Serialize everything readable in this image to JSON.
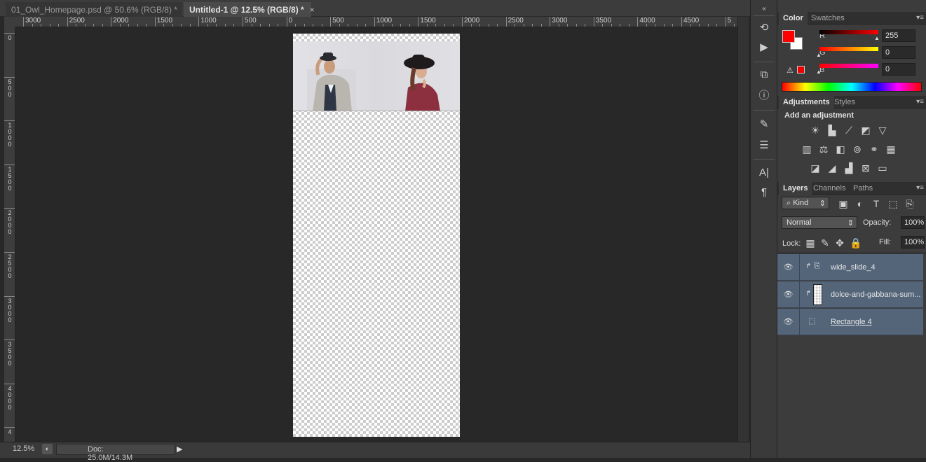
{
  "tabs": [
    {
      "label": "01_Owl_Homepage.psd @ 50.6% (RGB/8) *",
      "close": "×"
    },
    {
      "label": "Untitled-1 @ 12.5% (RGB/8) *",
      "close": "×"
    }
  ],
  "ruler": {
    "h_labels": [
      "3000",
      "2500",
      "2000",
      "1500",
      "1000",
      "500",
      "0",
      "500",
      "1000",
      "1500",
      "2000",
      "2500",
      "3000",
      "3500",
      "4000",
      "4500",
      "5"
    ],
    "v_labels": [
      "0",
      "5 0 0",
      "1 0 0 0",
      "1 5 0 0",
      "2 0 0 0",
      "2 5 0 0",
      "3 0 0 0",
      "3 5 0 0",
      "4 0 0 0",
      "4"
    ]
  },
  "status": {
    "zoom": "12.5%",
    "doc": "Doc: 25.0M/14.3M"
  },
  "colors": {
    "foreground": "#ff0000",
    "background": "#ffffff",
    "layer_highlight": "#546579"
  },
  "color_panel": {
    "tabs": [
      "Color",
      "Swatches"
    ],
    "r_label": "R",
    "r_value": "255",
    "g_label": "G",
    "g_value": "0",
    "b_label": "B",
    "b_value": "0"
  },
  "adjustments_panel": {
    "tabs": [
      "Adjustments",
      "Styles"
    ],
    "heading": "Add an adjustment",
    "icons": [
      "brightness-contrast-icon",
      "levels-icon",
      "curves-icon",
      "exposure-icon",
      "vibrance-icon",
      "hue-saturation-icon",
      "color-balance-icon",
      "black-white-icon",
      "photo-filter-icon",
      "channel-mixer-icon",
      "color-lookup-icon",
      "invert-icon",
      "posterize-icon",
      "threshold-icon",
      "selective-color-icon",
      "gradient-map-icon"
    ]
  },
  "layers_panel": {
    "tabs": [
      "Layers",
      "Channels",
      "Paths"
    ],
    "filter_label": "Kind",
    "blend_mode": "Normal",
    "opacity_label": "Opacity:",
    "opacity_value": "100%",
    "lock_label": "Lock:",
    "fill_label": "Fill:",
    "fill_value": "100%",
    "layers": [
      {
        "name": "wide_slide_4"
      },
      {
        "name": "dolce-and-gabbana-sum..."
      },
      {
        "name": "Rectangle 4"
      }
    ]
  }
}
